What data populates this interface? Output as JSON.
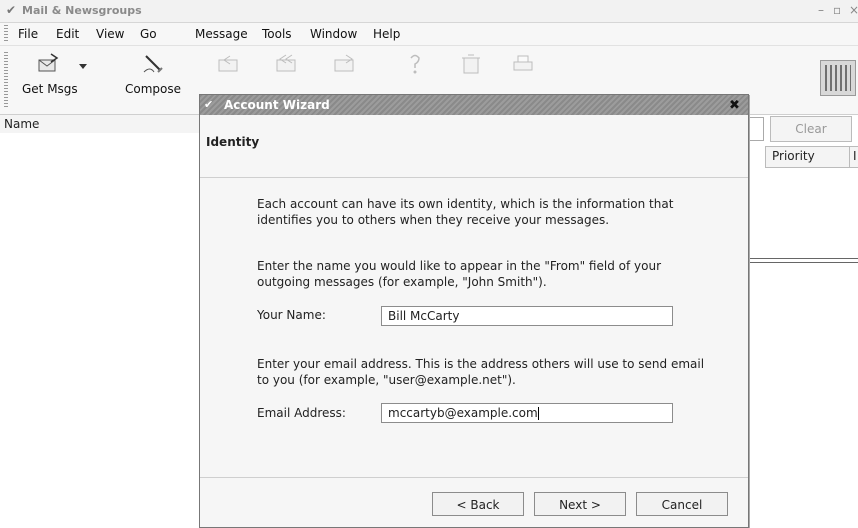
{
  "app": {
    "window_title": "Mail & Newsgroups"
  },
  "menubar": {
    "items": [
      {
        "label": "File"
      },
      {
        "label": "Edit"
      },
      {
        "label": "View"
      },
      {
        "label": "Go"
      },
      {
        "label": "Message"
      },
      {
        "label": "Tools"
      },
      {
        "label": "Window"
      },
      {
        "label": "Help"
      }
    ]
  },
  "toolbar": {
    "get_msgs": "Get Msgs",
    "compose": "Compose",
    "icons": [
      "get-msgs-icon",
      "compose-icon",
      "reply-icon",
      "reply-all-icon",
      "forward-icon",
      "next-icon",
      "delete-icon",
      "print-icon"
    ]
  },
  "folder_pane": {
    "name_header": "Name"
  },
  "message_pane": {
    "clear_button": "Clear",
    "priority_column": "Priority"
  },
  "dialog": {
    "title": "Account Wizard",
    "close_glyph": "✖",
    "header": "Identity",
    "intro": "Each account can have its own identity, which is the information that identifies you to others when they receive your messages.",
    "name_prompt": "Enter the name you would like to appear in the \"From\" field of your outgoing messages (for example, \"John Smith\").",
    "name_label": "Your Name:",
    "name_value": "Bill McCarty",
    "email_prompt": "Enter your email address. This is the address others will use to send email to you (for example, \"user@example.net\").",
    "email_label": "Email Address:",
    "email_value": "mccartyb@example.com",
    "buttons": {
      "back": "< Back",
      "next": "Next >",
      "cancel": "Cancel"
    }
  },
  "colors": {
    "dialog_title_bg": "#8a8a8a",
    "chrome_bg": "#f7f7f7",
    "input_border": "#8c8c8c"
  }
}
